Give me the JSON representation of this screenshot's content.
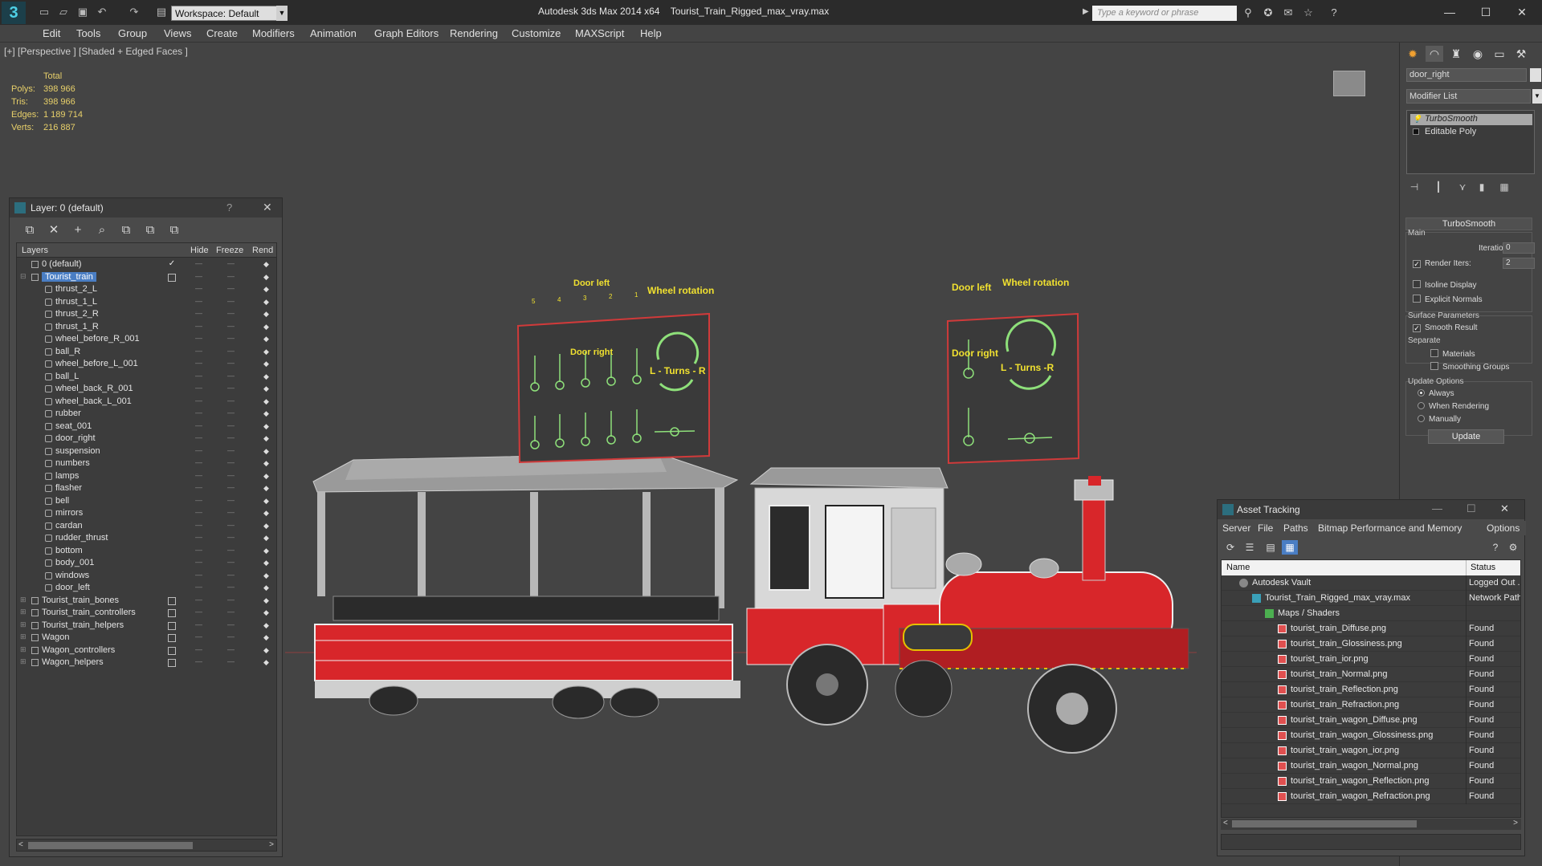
{
  "app": {
    "title": "Autodesk 3ds Max  2014 x64",
    "file": "Tourist_Train_Rigged_max_vray.max",
    "workspace": "Workspace: Default",
    "search_placeholder": "Type a keyword or phrase"
  },
  "menu": [
    "Edit",
    "Tools",
    "Group",
    "Views",
    "Create",
    "Modifiers",
    "Animation",
    "Graph Editors",
    "Rendering",
    "Customize",
    "MAXScript",
    "Help"
  ],
  "viewport": {
    "label": "[+] [Perspective ] [Shaded + Edged Faces ]",
    "stats": {
      "header": "Total",
      "rows": [
        {
          "label": "Polys:",
          "value": "398 966"
        },
        {
          "label": "Tris:",
          "value": "398 966"
        },
        {
          "label": "Edges:",
          "value": "1 189 714"
        },
        {
          "label": "Verts:",
          "value": "216 887"
        }
      ]
    },
    "panel_left": {
      "door_left": "Door left",
      "door_right": "Door right",
      "wheel_rotation": "Wheel rotation",
      "turns": "L - Turns - R",
      "nums": [
        "5",
        "4",
        "3",
        "2",
        "1"
      ]
    },
    "panel_right": {
      "door_left": "Door left",
      "door_right": "Door right",
      "wheel_rotation": "Wheel rotation",
      "turns": "L - Turns -R"
    }
  },
  "command_panel": {
    "object_name": "door_right",
    "modifier_list": "Modifier List",
    "stack": [
      "TurboSmooth",
      "Editable Poly"
    ],
    "rollout_title": "TurboSmooth",
    "main_label": "Main",
    "iterations_label": "Iterations:",
    "iterations_value": "0",
    "render_iters_label": "Render Iters:",
    "render_iters_value": "2",
    "isoline": "Isoline Display",
    "explicit_normals": "Explicit Normals",
    "surface_params": "Surface Parameters",
    "smooth_result": "Smooth Result",
    "separate": "Separate",
    "materials": "Materials",
    "smoothing_groups": "Smoothing Groups",
    "update_options": "Update Options",
    "always": "Always",
    "when_rendering": "When Rendering",
    "manually": "Manually",
    "update_button": "Update"
  },
  "layer_window": {
    "title": "Layer: 0 (default)",
    "columns": {
      "layers": "Layers",
      "hide": "Hide",
      "freeze": "Freeze",
      "render": "Rend"
    },
    "layers_top": [
      {
        "name": "0 (default)",
        "current": true
      },
      {
        "name": "Tourist_train",
        "selected": true
      }
    ],
    "objects": [
      "thrust_2_L",
      "thrust_1_L",
      "thrust_2_R",
      "thrust_1_R",
      "wheel_before_R_001",
      "ball_R",
      "wheel_before_L_001",
      "ball_L",
      "wheel_back_R_001",
      "wheel_back_L_001",
      "rubber",
      "seat_001",
      "door_right",
      "suspension",
      "numbers",
      "lamps",
      "flasher",
      "bell",
      "mirrors",
      "cardan",
      "rudder_thrust",
      "bottom",
      "body_001",
      "windows",
      "door_left"
    ],
    "layers_bottom": [
      "Tourist_train_bones",
      "Tourist_train_controllers",
      "Tourist_train_helpers",
      "Wagon",
      "Wagon_controllers",
      "Wagon_helpers"
    ]
  },
  "asset_tracking": {
    "title": "Asset Tracking",
    "menu": [
      "Server",
      "File",
      "Paths",
      "Bitmap Performance and Memory",
      "Options"
    ],
    "columns": {
      "name": "Name",
      "status": "Status"
    },
    "vault": {
      "name": "Autodesk Vault",
      "status": "Logged Out ..."
    },
    "file": {
      "name": "Tourist_Train_Rigged_max_vray.max",
      "status": "Network Path"
    },
    "maps_label": "Maps / Shaders",
    "maps": [
      {
        "name": "tourist_train_Diffuse.png",
        "status": "Found"
      },
      {
        "name": "tourist_train_Glossiness.png",
        "status": "Found"
      },
      {
        "name": "tourist_train_ior.png",
        "status": "Found"
      },
      {
        "name": "tourist_train_Normal.png",
        "status": "Found"
      },
      {
        "name": "tourist_train_Reflection.png",
        "status": "Found"
      },
      {
        "name": "tourist_train_Refraction.png",
        "status": "Found"
      },
      {
        "name": "tourist_train_wagon_Diffuse.png",
        "status": "Found"
      },
      {
        "name": "tourist_train_wagon_Glossiness.png",
        "status": "Found"
      },
      {
        "name": "tourist_train_wagon_ior.png",
        "status": "Found"
      },
      {
        "name": "tourist_train_wagon_Normal.png",
        "status": "Found"
      },
      {
        "name": "tourist_train_wagon_Reflection.png",
        "status": "Found"
      },
      {
        "name": "tourist_train_wagon_Refraction.png",
        "status": "Found"
      }
    ]
  },
  "colors": {
    "accent_blue": "#4a7ec4",
    "stats_yellow": "#e8d06a",
    "train_red": "#d8262a",
    "control_yellow": "#f0e030",
    "control_green": "#8ee07a"
  }
}
